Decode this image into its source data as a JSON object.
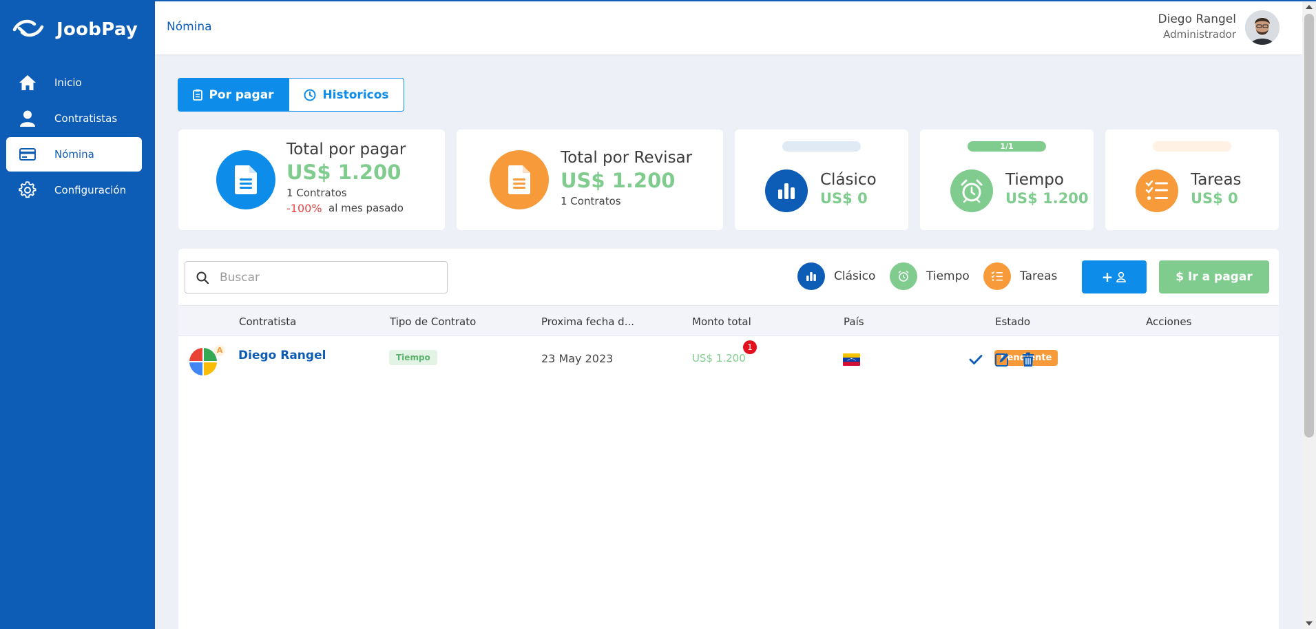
{
  "app": {
    "name": "JoobPay"
  },
  "sidebar": {
    "items": [
      {
        "label": "Inicio",
        "icon": "home-icon"
      },
      {
        "label": "Contratistas",
        "icon": "person-icon"
      },
      {
        "label": "Nómina",
        "icon": "credit-card-icon",
        "active": true
      },
      {
        "label": "Configuración",
        "icon": "gear-icon"
      }
    ]
  },
  "header": {
    "breadcrumb": "Nómina",
    "user_name": "Diego Rangel",
    "user_role": "Administrador"
  },
  "tabs": [
    {
      "label": "Por pagar",
      "icon": "clipboard-icon",
      "active": true
    },
    {
      "label": "Historicos",
      "icon": "clock-icon"
    }
  ],
  "stats": {
    "total_por_pagar": {
      "title": "Total por pagar",
      "amount": "US$ 1.200",
      "contracts": "1 Contratos",
      "change": "-100%",
      "change_label": "al mes pasado"
    },
    "total_por_revisar": {
      "title": "Total por Revisar",
      "amount": "US$ 1.200",
      "contracts": "1 Contratos"
    },
    "clasico": {
      "title": "Clásico",
      "amount": "US$ 0",
      "pill": ""
    },
    "tiempo": {
      "title": "Tiempo",
      "amount": "US$ 1.200",
      "pill": "1/1"
    },
    "tareas": {
      "title": "Tareas",
      "amount": "US$ 0",
      "pill": ""
    }
  },
  "search": {
    "placeholder": "Buscar",
    "value": ""
  },
  "legend": [
    {
      "label": "Clásico",
      "color": "#0d5cb6",
      "icon": "bar-chart-icon"
    },
    {
      "label": "Tiempo",
      "color": "#7fcc8e",
      "icon": "alarm-clock-icon"
    },
    {
      "label": "Tareas",
      "color": "#f79a3a",
      "icon": "task-list-icon"
    }
  ],
  "buttons": {
    "add_contractor": "+",
    "pay": "$ Ir a pagar"
  },
  "table": {
    "columns": [
      "Contratista",
      "Tipo de Contrato",
      "Proxima fecha d...",
      "Monto total",
      "País",
      "Estado",
      "Acciones"
    ],
    "rows": [
      {
        "avatar_initial": "A",
        "name": "Diego Rangel",
        "contract_type": "Tiempo",
        "next_date": "23 May 2023",
        "amount": "US$ 1.200",
        "notifications": "1",
        "country_flag": "venezuela-flag-icon",
        "status": "Pendiente"
      }
    ]
  },
  "colors": {
    "primary": "#0d5cb6",
    "accent": "#0d8de9",
    "success": "#7fcc8e",
    "warning": "#f79a3a",
    "danger": "#e5101e"
  }
}
